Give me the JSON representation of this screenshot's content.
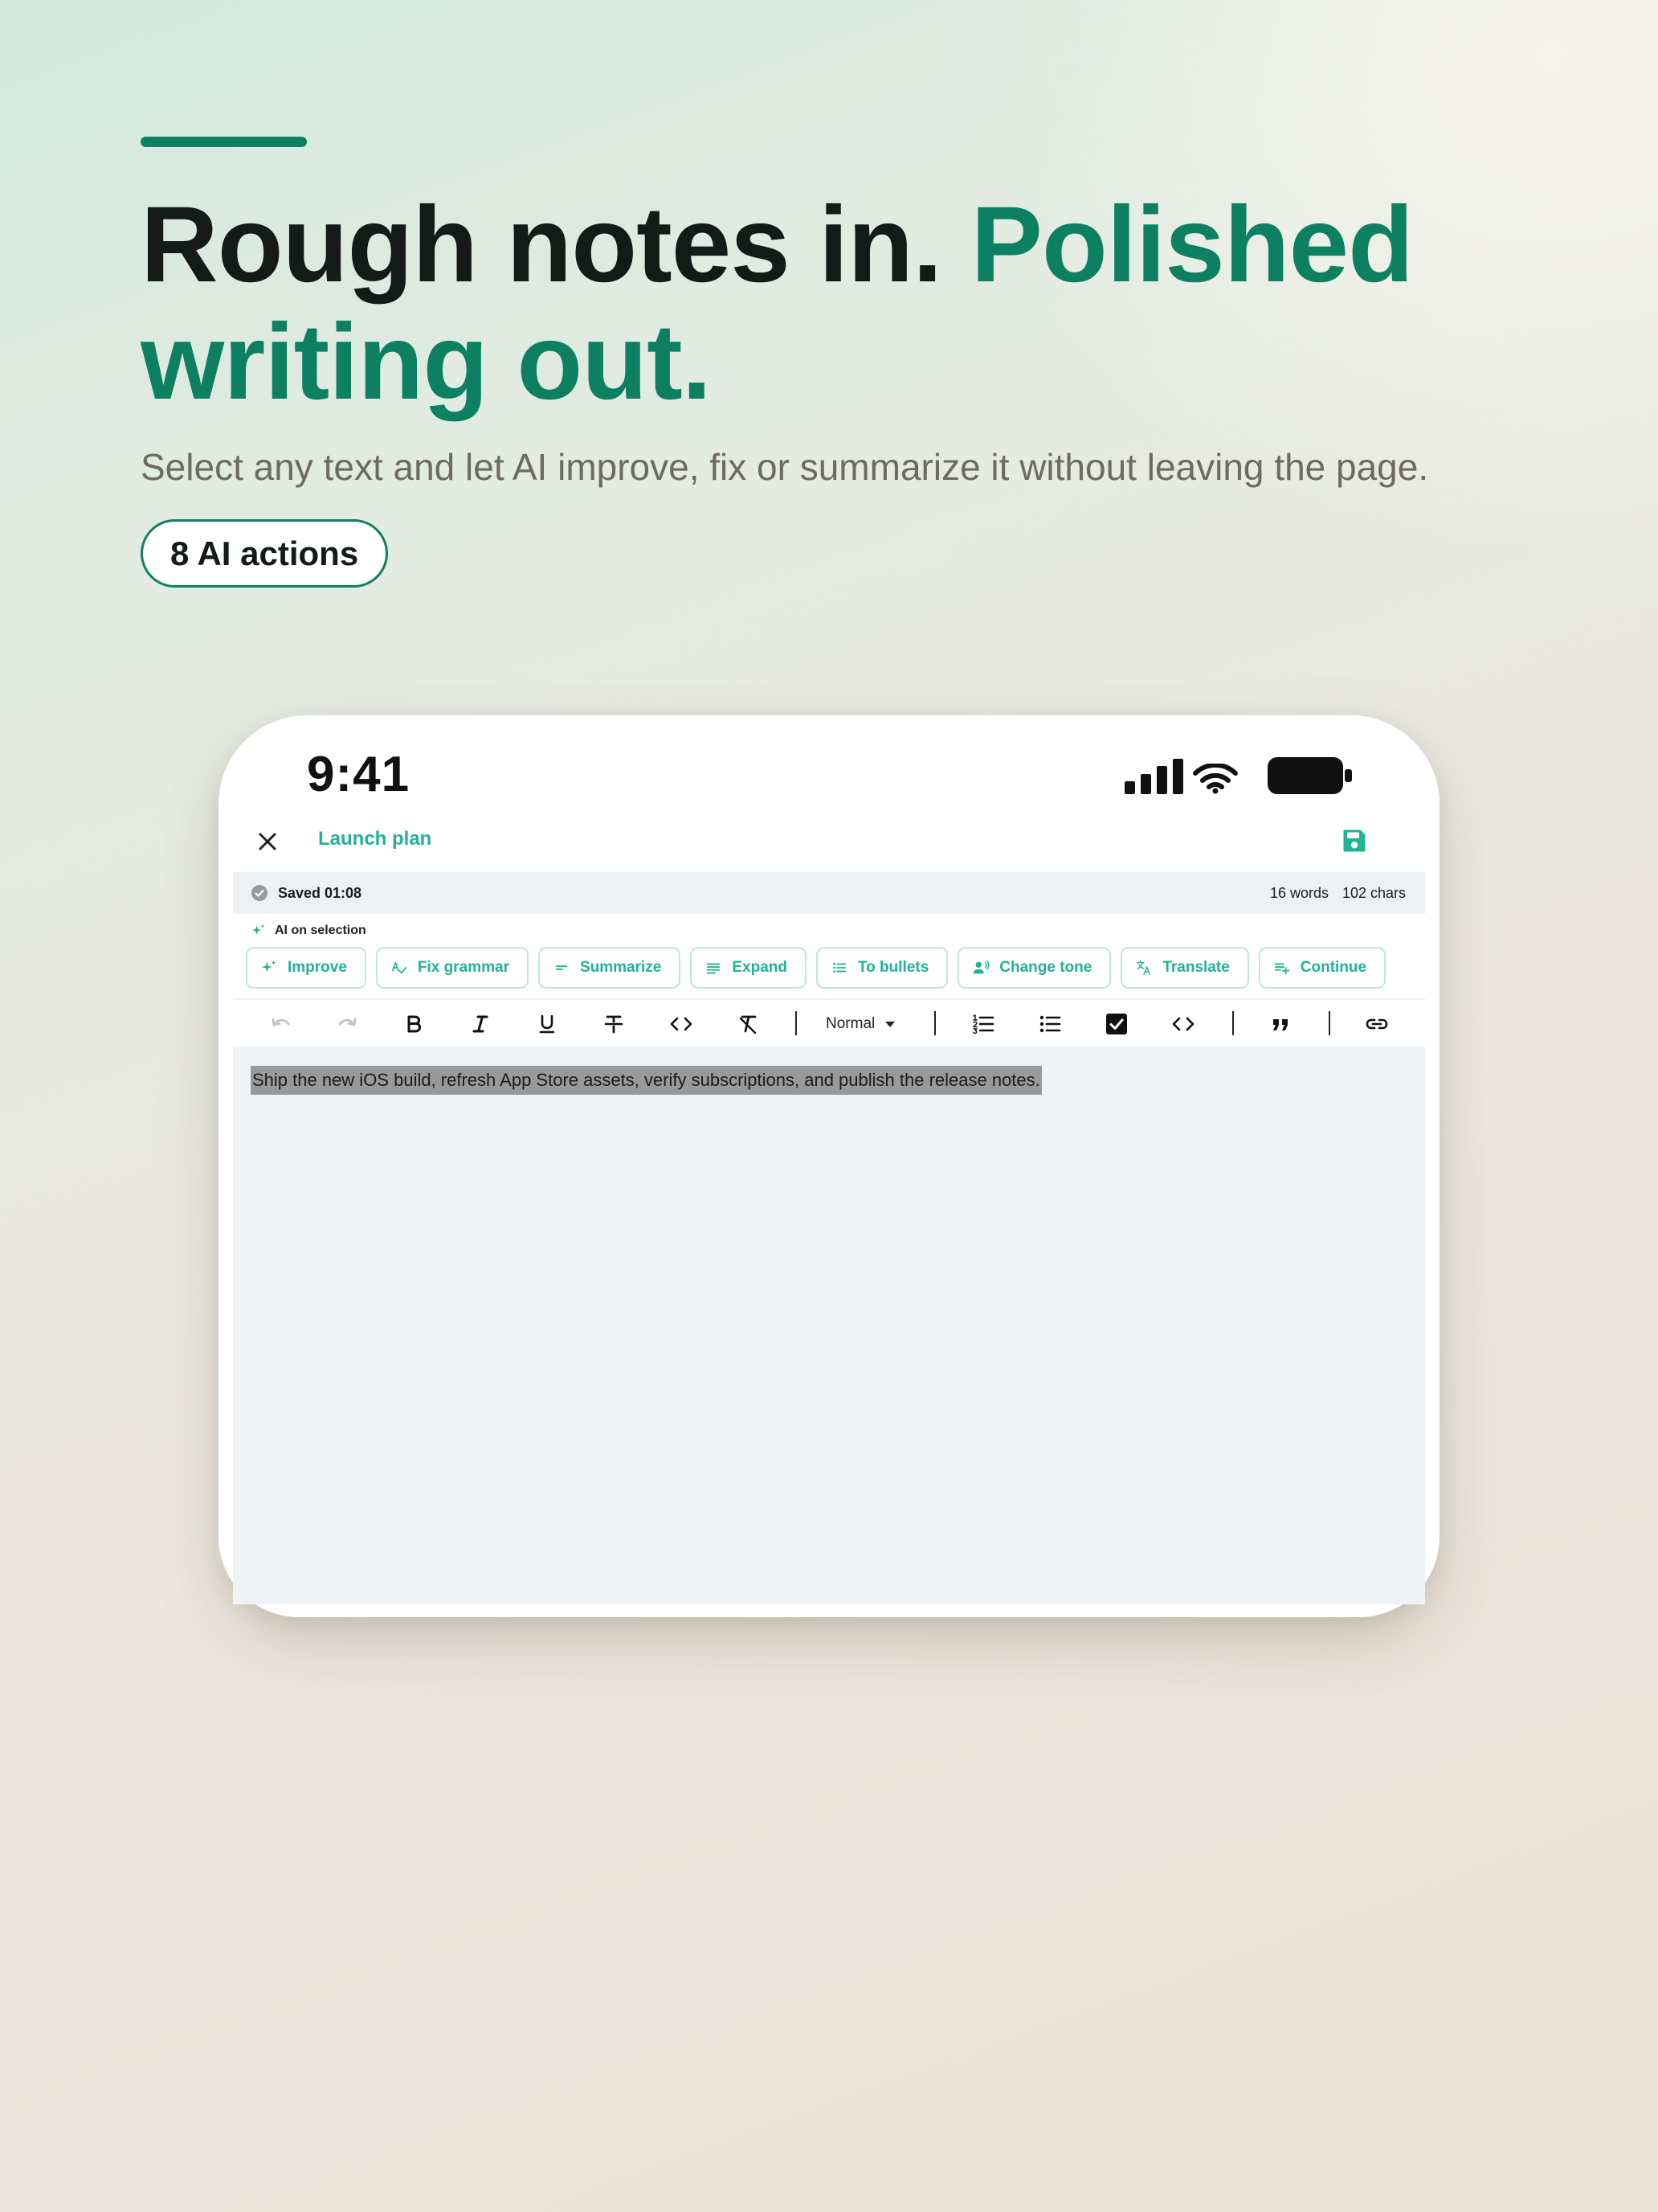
{
  "hero": {
    "headline_dark": "Rough notes in. ",
    "headline_green": "Polished writing out.",
    "subhead": "Select any text and let AI improve, fix or summarize it without leaving the page.",
    "pill": "8 AI actions"
  },
  "colors": {
    "accent": "#0e8062",
    "mint": "#1fb393",
    "selection": "#999999"
  },
  "status_bar": {
    "time": "9:41"
  },
  "nav": {
    "title": "Launch plan",
    "close_icon": "close-icon",
    "save_icon": "save-icon"
  },
  "doc_status": {
    "saved": "Saved 01:08",
    "words": "16 words",
    "chars": "102 chars"
  },
  "ai": {
    "label": "AI on selection",
    "actions": [
      {
        "label": "Improve",
        "icon": "sparkle-icon"
      },
      {
        "label": "Fix grammar",
        "icon": "spellcheck-icon"
      },
      {
        "label": "Summarize",
        "icon": "short-text-icon"
      },
      {
        "label": "Expand",
        "icon": "long-text-icon"
      },
      {
        "label": "To bullets",
        "icon": "bulleted-list-icon"
      },
      {
        "label": "Change tone",
        "icon": "voice-icon"
      },
      {
        "label": "Translate",
        "icon": "translate-icon"
      },
      {
        "label": "Continue",
        "icon": "playlist-add-icon"
      }
    ]
  },
  "toolbar": {
    "heading_select": "Normal"
  },
  "editor": {
    "text": "Ship the new iOS build, refresh App Store assets, verify subscriptions, and publish the release notes."
  }
}
